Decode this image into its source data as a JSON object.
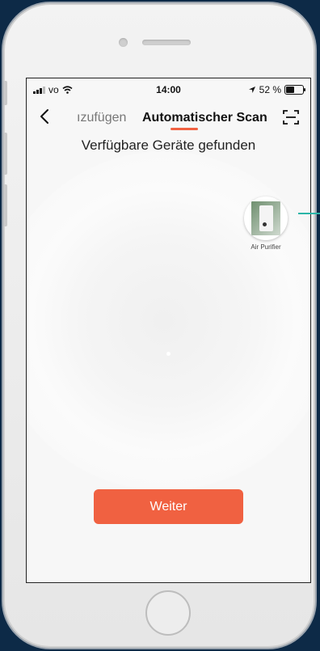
{
  "status_bar": {
    "carrier": "vo",
    "time": "14:00",
    "battery": "52 %",
    "battery_level": 0.52
  },
  "nav": {
    "back_icon": "chevron-left-icon",
    "tab_previous": "ızufügen",
    "tab_active": "Automatischer Scan",
    "scan_icon": "scan-frame-icon"
  },
  "main": {
    "heading": "Verfügbare Geräte gefunden",
    "devices": [
      {
        "label": "Air Purifier",
        "icon": "air-purifier-icon"
      }
    ],
    "continue_label": "Weiter"
  },
  "colors": {
    "accent": "#f06141",
    "background": "#0d2a47",
    "edge_line": "#2bb5a8"
  }
}
